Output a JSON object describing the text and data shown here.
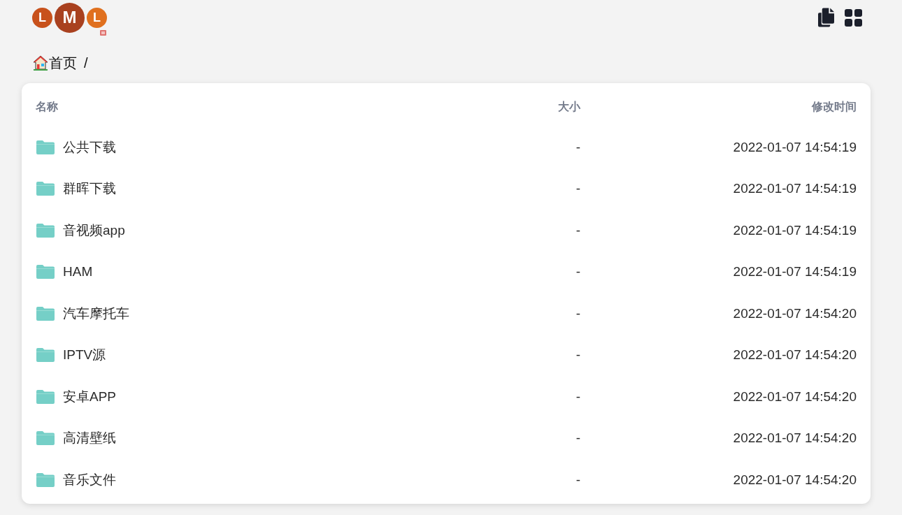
{
  "logo": {
    "letters": [
      {
        "text": "L",
        "color": "#c8511b",
        "kind": "small"
      },
      {
        "text": "M",
        "color": "#a9411f",
        "kind": "large"
      },
      {
        "text": "L",
        "color": "#e0701e",
        "kind": "small"
      }
    ]
  },
  "breadcrumb": {
    "items": [
      {
        "label": "首页",
        "kind": "home"
      }
    ],
    "separator": "/"
  },
  "table": {
    "columns": [
      "名称",
      "大小",
      "修改时间"
    ],
    "rows": [
      {
        "kind": "folder",
        "name": "公共下载",
        "size": "-",
        "modified": "2022-01-07 14:54:19"
      },
      {
        "kind": "folder",
        "name": "群晖下载",
        "size": "-",
        "modified": "2022-01-07 14:54:19"
      },
      {
        "kind": "folder",
        "name": "音视频app",
        "size": "-",
        "modified": "2022-01-07 14:54:19"
      },
      {
        "kind": "folder",
        "name": "HAM",
        "size": "-",
        "modified": "2022-01-07 14:54:19"
      },
      {
        "kind": "folder",
        "name": "汽车摩托车",
        "size": "-",
        "modified": "2022-01-07 14:54:20"
      },
      {
        "kind": "folder",
        "name": "IPTV源",
        "size": "-",
        "modified": "2022-01-07 14:54:20"
      },
      {
        "kind": "folder",
        "name": "安卓APP",
        "size": "-",
        "modified": "2022-01-07 14:54:20"
      },
      {
        "kind": "folder",
        "name": "高清壁纸",
        "size": "-",
        "modified": "2022-01-07 14:54:20"
      },
      {
        "kind": "folder",
        "name": "音乐文件",
        "size": "-",
        "modified": "2022-01-07 14:54:20"
      }
    ]
  }
}
